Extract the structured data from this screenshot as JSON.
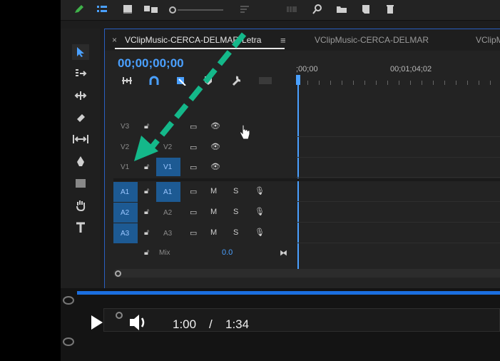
{
  "sequence": {
    "tabs": [
      "VClipMusic-CERCA-DELMAR-Letra",
      "VClipMusic-CERCA-DELMAR",
      "VClipM"
    ],
    "close_glyph": "×",
    "menu_glyph": "≡",
    "timecode": "00;00;00;00",
    "ruler": {
      "start": ";00;00",
      "mark": "00;01;04;02"
    }
  },
  "tracks": {
    "video": [
      {
        "label": "V3",
        "target": ""
      },
      {
        "label": "V2",
        "target": "V2"
      },
      {
        "label": "V1",
        "target": "V1"
      }
    ],
    "audio": [
      {
        "label": "A1",
        "target": "A1",
        "m": "M",
        "s": "S"
      },
      {
        "label": "A2",
        "target": "A2",
        "m": "M",
        "s": "S"
      },
      {
        "label": "A3",
        "target": "A3",
        "m": "M",
        "s": "S"
      }
    ],
    "mix": {
      "label": "Mix",
      "value": "0.0"
    }
  },
  "player": {
    "current_time": "1:00",
    "separator": "/",
    "duration": "1:34"
  },
  "colors": {
    "accent": "#4aa0ff",
    "target": "#1d5a93",
    "arrow": "#14b88a",
    "progress": "#1b6fe0"
  }
}
